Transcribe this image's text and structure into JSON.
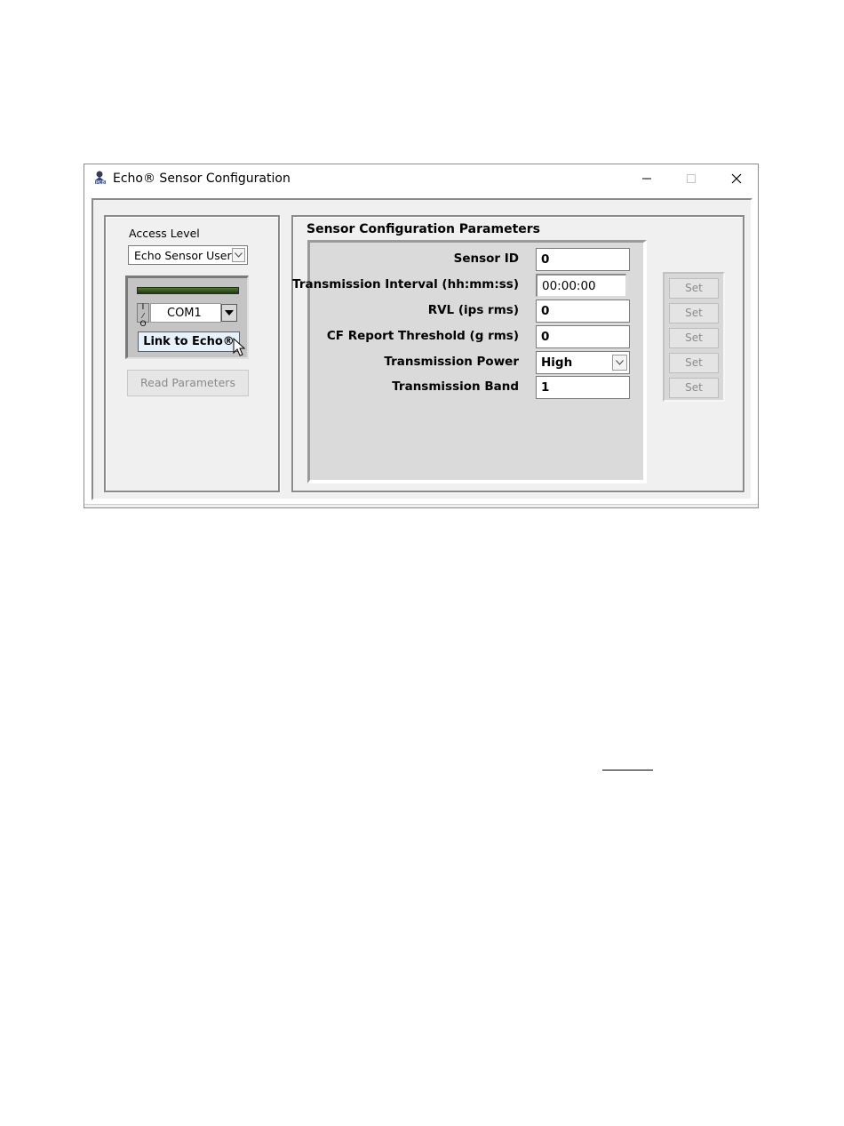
{
  "window": {
    "title": "Echo® Sensor Configuration"
  },
  "left_panel": {
    "access_level_label": "Access Level",
    "access_level_value": "Echo Sensor User",
    "com_port": "COM1",
    "io_glyph_top": "I",
    "io_glyph_bottom": "O",
    "link_button": "Link to Echo®",
    "read_button": "Read Parameters"
  },
  "right_panel": {
    "title": "Sensor Configuration Parameters",
    "params": [
      {
        "label": "Sensor ID",
        "value": "0"
      },
      {
        "label": "Transmission Interval (hh:mm:ss)",
        "value": "00:00:00"
      },
      {
        "label": "RVL (ips rms)",
        "value": "0"
      },
      {
        "label": "CF Report Threshold (g rms)",
        "value": "0"
      },
      {
        "label": "Transmission Power",
        "value": "High"
      },
      {
        "label": "Transmission Band",
        "value": "1"
      }
    ],
    "set_label": "Set"
  },
  "icons": {
    "app": "pcb-app-icon",
    "minimize": "minimize-icon",
    "maximize": "maximize-icon",
    "close": "close-icon"
  }
}
